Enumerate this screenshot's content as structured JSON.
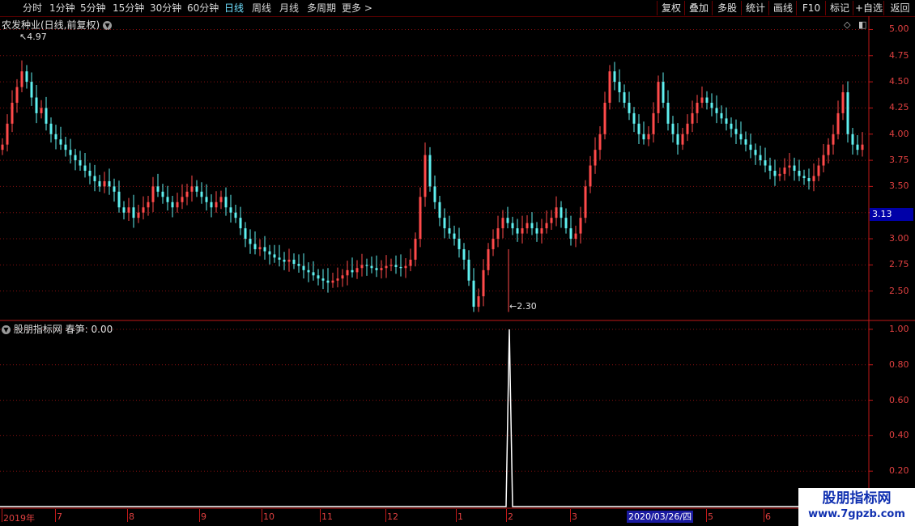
{
  "toolbar": {
    "periods": [
      "分时",
      "1分钟",
      "5分钟",
      "15分钟",
      "30分钟",
      "60分钟",
      "日线",
      "周线",
      "月线",
      "多周期",
      "更多 >"
    ],
    "active_period": "日线",
    "tools": [
      "复权",
      "叠加",
      "多股",
      "统计",
      "画线",
      "F10",
      "标记",
      "+自选",
      "返回"
    ]
  },
  "main_panel": {
    "title": "农发种业(日线,前复权)",
    "current_price": "3.13",
    "high_label": "4.97",
    "low_label": "2.30",
    "y_ticks": [
      "5.00",
      "4.75",
      "4.50",
      "4.25",
      "4.00",
      "3.75",
      "3.50",
      "3.25",
      "3.00",
      "2.75",
      "2.50"
    ]
  },
  "indicator_panel": {
    "title": "股朋指标网",
    "series_label": "春笋: 0.00",
    "y_ticks": [
      "1.00",
      "0.80",
      "0.60",
      "0.40",
      "0.20"
    ]
  },
  "x_axis": {
    "labels": [
      "2019年",
      "7",
      "8",
      "9",
      "10",
      "11",
      "12",
      "1",
      "2",
      "3",
      "2020/03/26/四",
      "5",
      "6"
    ],
    "selected_date": "2020/03/26/四"
  },
  "watermark": {
    "line1": "股朋指标网",
    "line2": "www.7gpzb.com"
  },
  "colors": {
    "up": "#ff4a4a",
    "down": "#5ff0f0",
    "grid": "#8a1010",
    "axis": "#c01818",
    "line": "#ffffff"
  },
  "chart_data": [
    {
      "type": "candlestick",
      "title": "农发种业(日线,前复权)",
      "ylim": [
        2.25,
        5.05
      ],
      "high": 4.97,
      "low": 2.3,
      "close_last": 3.13,
      "months": [
        "2019-06",
        "2019-07",
        "2019-08",
        "2019-09",
        "2019-10",
        "2019-11",
        "2019-12",
        "2020-01",
        "2020-02",
        "2020-03",
        "2020-04",
        "2020-05",
        "2020-06"
      ],
      "closes": [
        3.9,
        4.1,
        4.3,
        4.45,
        4.6,
        4.5,
        4.35,
        4.2,
        4.25,
        4.1,
        4.0,
        3.95,
        3.9,
        3.85,
        3.8,
        3.75,
        3.7,
        3.65,
        3.6,
        3.55,
        3.5,
        3.55,
        3.5,
        3.45,
        3.3,
        3.25,
        3.3,
        3.2,
        3.25,
        3.3,
        3.35,
        3.5,
        3.45,
        3.4,
        3.35,
        3.3,
        3.35,
        3.4,
        3.45,
        3.5,
        3.45,
        3.4,
        3.35,
        3.3,
        3.35,
        3.4,
        3.3,
        3.25,
        3.2,
        3.1,
        3.0,
        2.95,
        2.9,
        2.92,
        2.88,
        2.85,
        2.82,
        2.8,
        2.78,
        2.8,
        2.76,
        2.74,
        2.7,
        2.68,
        2.65,
        2.62,
        2.6,
        2.58,
        2.6,
        2.62,
        2.65,
        2.7,
        2.68,
        2.72,
        2.75,
        2.74,
        2.72,
        2.7,
        2.72,
        2.74,
        2.75,
        2.73,
        2.72,
        2.74,
        2.8,
        3.0,
        3.4,
        3.8,
        3.5,
        3.35,
        3.2,
        3.1,
        3.05,
        3.0,
        2.9,
        2.8,
        2.6,
        2.35,
        2.45,
        2.7,
        2.9,
        3.0,
        3.1,
        3.2,
        3.15,
        3.1,
        3.05,
        3.1,
        3.15,
        3.1,
        3.05,
        3.1,
        3.15,
        3.2,
        3.3,
        3.2,
        3.1,
        3.0,
        3.05,
        3.2,
        3.5,
        3.7,
        3.85,
        4.0,
        4.3,
        4.6,
        4.5,
        4.4,
        4.3,
        4.2,
        4.1,
        4.0,
        3.95,
        4.0,
        4.2,
        4.5,
        4.3,
        4.1,
        4.0,
        3.9,
        4.0,
        4.1,
        4.2,
        4.3,
        4.35,
        4.3,
        4.25,
        4.2,
        4.15,
        4.1,
        4.05,
        4.0,
        3.95,
        3.9,
        3.85,
        3.8,
        3.75,
        3.7,
        3.65,
        3.6,
        3.62,
        3.68,
        3.7,
        3.65,
        3.6,
        3.58,
        3.55,
        3.6,
        3.7,
        3.8,
        3.9,
        4.0,
        4.2,
        4.4,
        4.0,
        3.9,
        3.85,
        3.9
      ]
    },
    {
      "type": "line",
      "series_name": "春笋",
      "ylim": [
        0,
        1.05
      ],
      "baseline": 0,
      "spike_value": 1.0,
      "spike_date": "2020-02-04",
      "last_value": 0.0
    }
  ]
}
